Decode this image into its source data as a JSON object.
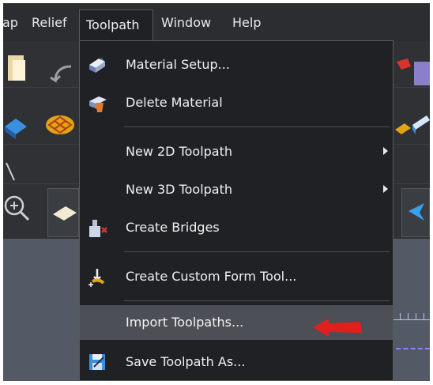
{
  "menubar": {
    "items": [
      "ap",
      "Relief",
      "Toolpath",
      "Window",
      "Help"
    ]
  },
  "toolpath_menu": {
    "items": [
      {
        "label": "Material Setup...",
        "icon": "material-setup-icon"
      },
      {
        "label": "Delete Material",
        "icon": "delete-material-icon"
      },
      {
        "label": "New 2D Toolpath",
        "submenu": true
      },
      {
        "label": "New 3D Toolpath",
        "submenu": true
      },
      {
        "label": "Create Bridges",
        "icon": "create-bridges-icon"
      },
      {
        "label": "Create Custom Form Tool...",
        "icon": "custom-form-tool-icon"
      },
      {
        "label": "Import Toolpaths...",
        "highlighted": true
      },
      {
        "label": "Save Toolpath As...",
        "icon": "save-toolpath-icon"
      }
    ]
  },
  "colors": {
    "menu_bg": "#202124",
    "highlight": "#4c4f55",
    "annotation_arrow": "#e0201c"
  }
}
